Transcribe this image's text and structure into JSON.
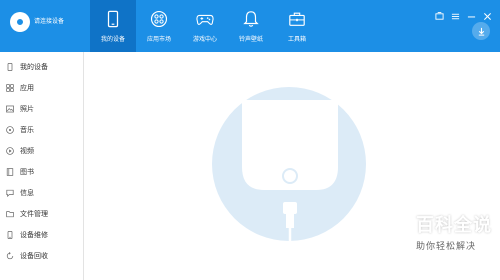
{
  "header": {
    "connect_text": "请连接设备",
    "nav": [
      {
        "label": "我的设备",
        "icon": "phone-icon",
        "active": true
      },
      {
        "label": "应用市场",
        "icon": "apps-icon",
        "active": false
      },
      {
        "label": "游戏中心",
        "icon": "gamepad-icon",
        "active": false
      },
      {
        "label": "铃声壁纸",
        "icon": "bell-icon",
        "active": false
      },
      {
        "label": "工具箱",
        "icon": "toolbox-icon",
        "active": false
      }
    ]
  },
  "sidebar": {
    "items": [
      {
        "label": "我的设备",
        "icon": "device-icon"
      },
      {
        "label": "应用",
        "icon": "app-icon"
      },
      {
        "label": "照片",
        "icon": "photo-icon"
      },
      {
        "label": "音乐",
        "icon": "music-icon"
      },
      {
        "label": "视频",
        "icon": "video-icon"
      },
      {
        "label": "图书",
        "icon": "book-icon"
      },
      {
        "label": "信息",
        "icon": "message-icon"
      },
      {
        "label": "文件管理",
        "icon": "folder-icon"
      },
      {
        "label": "设备维修",
        "icon": "repair-icon"
      },
      {
        "label": "设备回收",
        "icon": "recycle-icon"
      }
    ]
  },
  "watermark": {
    "title": "百科全说",
    "subtitle": "助你轻松解决"
  },
  "colors": {
    "accent": "#1c8fe6",
    "active_tab": "#0f73c7",
    "illustration": "#dcebf7"
  }
}
